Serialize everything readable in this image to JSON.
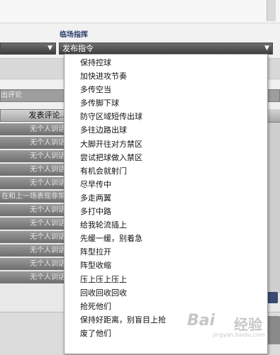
{
  "header": {
    "field_label": "临场指挥"
  },
  "command_select": {
    "value": "发布指令"
  },
  "comment_input": {
    "value": "出评论"
  },
  "list": {
    "header": "发表评论...",
    "rows": [
      "无个人训话",
      "无个人训话",
      "无个人训话",
      "无个人训话",
      "无个人训话",
      "在和上一场表现非常",
      "无个人训话",
      "无个人训话",
      "无个人训话",
      "无个人训话",
      "无个人训话",
      "无个人训话"
    ]
  },
  "dropdown": {
    "options": [
      "保持控球",
      "加快进攻节奏",
      "多传空当",
      "多传脚下球",
      "防守区域短传出球",
      "多往边路出球",
      "大脚开往对方禁区",
      "尝试把球做入禁区",
      "有机会就射门",
      "尽早传中",
      "多走两翼",
      "多打中路",
      "给我轮流插上",
      "先缓一缓，别着急",
      "阵型拉开",
      "阵型收缩",
      "压上压上压上",
      "回收回收回收",
      "抢死他们",
      "保持好距离，别盲目上抢",
      "废了他们"
    ]
  },
  "watermark": {
    "brand": "Bai",
    "brand2": "经验",
    "url": "jingyan.baidu.com"
  }
}
